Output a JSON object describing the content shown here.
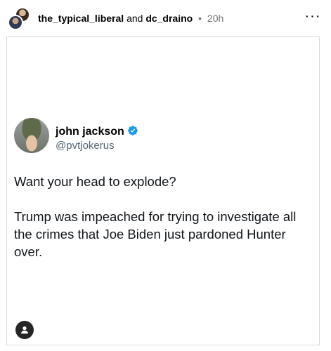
{
  "header": {
    "user1": "the_typical_liberal",
    "conjunction": "and",
    "user2": "dc_draino",
    "separator": "•",
    "time": "20h",
    "more_label": "···"
  },
  "tweet": {
    "name": "john jackson",
    "handle": "@pvtjokerus",
    "paragraph1": "Want your head to explode?",
    "paragraph2": "Trump was impeached for trying to investigate all the crimes that Joe Biden just pardoned Hunter over."
  },
  "colors": {
    "verified": "#1d9bf0",
    "secondary_text": "#737373",
    "handle": "#536471",
    "border": "#dbdbdb"
  },
  "icons": {
    "verified": "verified-badge-icon",
    "more": "more-options-icon",
    "tag": "user-tag-icon"
  }
}
